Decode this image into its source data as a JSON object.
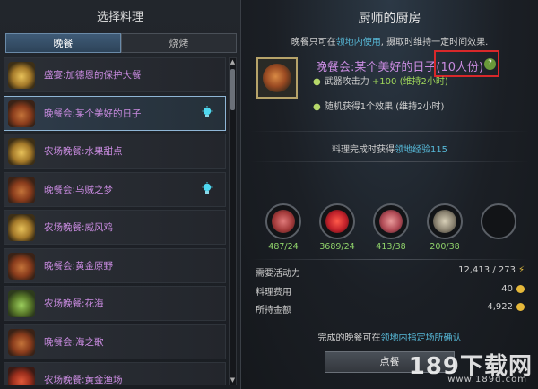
{
  "left_panel": {
    "title": "选择料理",
    "tabs": [
      {
        "label": "晚餐",
        "active": true
      },
      {
        "label": "烧烤",
        "active": false
      }
    ],
    "items": [
      {
        "name": "盛宴:加德恩的保护大餐",
        "icon": "feast-dish-icon",
        "color": "gold",
        "bulb": false,
        "selected": false
      },
      {
        "name": "晚餐会:某个美好的日子",
        "icon": "dinner-dish-icon",
        "color": "",
        "bulb": true,
        "selected": true
      },
      {
        "name": "农场晚餐:水果甜点",
        "icon": "fruit-dessert-icon",
        "color": "gold",
        "bulb": false,
        "selected": false
      },
      {
        "name": "晚餐会:乌贼之梦",
        "icon": "squid-dish-icon",
        "color": "",
        "bulb": true,
        "selected": false
      },
      {
        "name": "农场晚餐:威风鸡",
        "icon": "chicken-dish-icon",
        "color": "gold",
        "bulb": false,
        "selected": false
      },
      {
        "name": "晚餐会:黄金原野",
        "icon": "golden-field-dish-icon",
        "color": "",
        "bulb": false,
        "selected": false
      },
      {
        "name": "农场晚餐:花海",
        "icon": "flower-sea-dish-icon",
        "color": "green",
        "bulb": false,
        "selected": false
      },
      {
        "name": "晚餐会:海之歌",
        "icon": "sea-song-dish-icon",
        "color": "",
        "bulb": false,
        "selected": false
      },
      {
        "name": "农场晚餐:黄金渔场",
        "icon": "golden-fishery-dish-icon",
        "color": "red",
        "bulb": false,
        "selected": false
      }
    ]
  },
  "right_panel": {
    "title": "厨师的厨房",
    "subtitle_pre": "晚餐只可在",
    "subtitle_hl": "领地内使用",
    "subtitle_post": ", 摄取时维持一定时间效果.",
    "dish_name": "晚餐会:某个美好的日子",
    "dish_qty": "(10人份)",
    "help_label": "?",
    "effects": [
      {
        "text": "武器攻击力 ",
        "bonus": "+100 (维持2小时)"
      },
      {
        "text": "随机获得1个效果 (维持2小时)",
        "bonus": ""
      }
    ],
    "exp_pre": "料理完成时获得",
    "exp_hl": "领地经验115",
    "ingredients": [
      {
        "name": "meat-ingredient-icon",
        "count": "487/24"
      },
      {
        "name": "berries-ingredient-icon",
        "count": "3689/24"
      },
      {
        "name": "raw-steak-ingredient-icon",
        "count": "413/38"
      },
      {
        "name": "fish-ingredient-icon",
        "count": "200/38"
      },
      {
        "name": "empty-ingredient-slot",
        "count": ""
      }
    ],
    "costs": {
      "activity_label": "需要活动力",
      "activity_value": "12,413 / 273",
      "fee_label": "料理费用",
      "fee_value": "40",
      "gold_label": "所持金额",
      "gold_value": "4,922"
    },
    "note_pre": "完成的晚餐可在",
    "note_hl": "领地内指定场所确认",
    "cook_button": "点餐"
  },
  "watermark": {
    "text": "189下载网",
    "url": "www.189d.com"
  },
  "colors": {
    "accent": "#57b9d8",
    "dish_purple": "#c98be0",
    "highlight_box": "#d8282a",
    "bonus_green": "#9fd65a"
  }
}
